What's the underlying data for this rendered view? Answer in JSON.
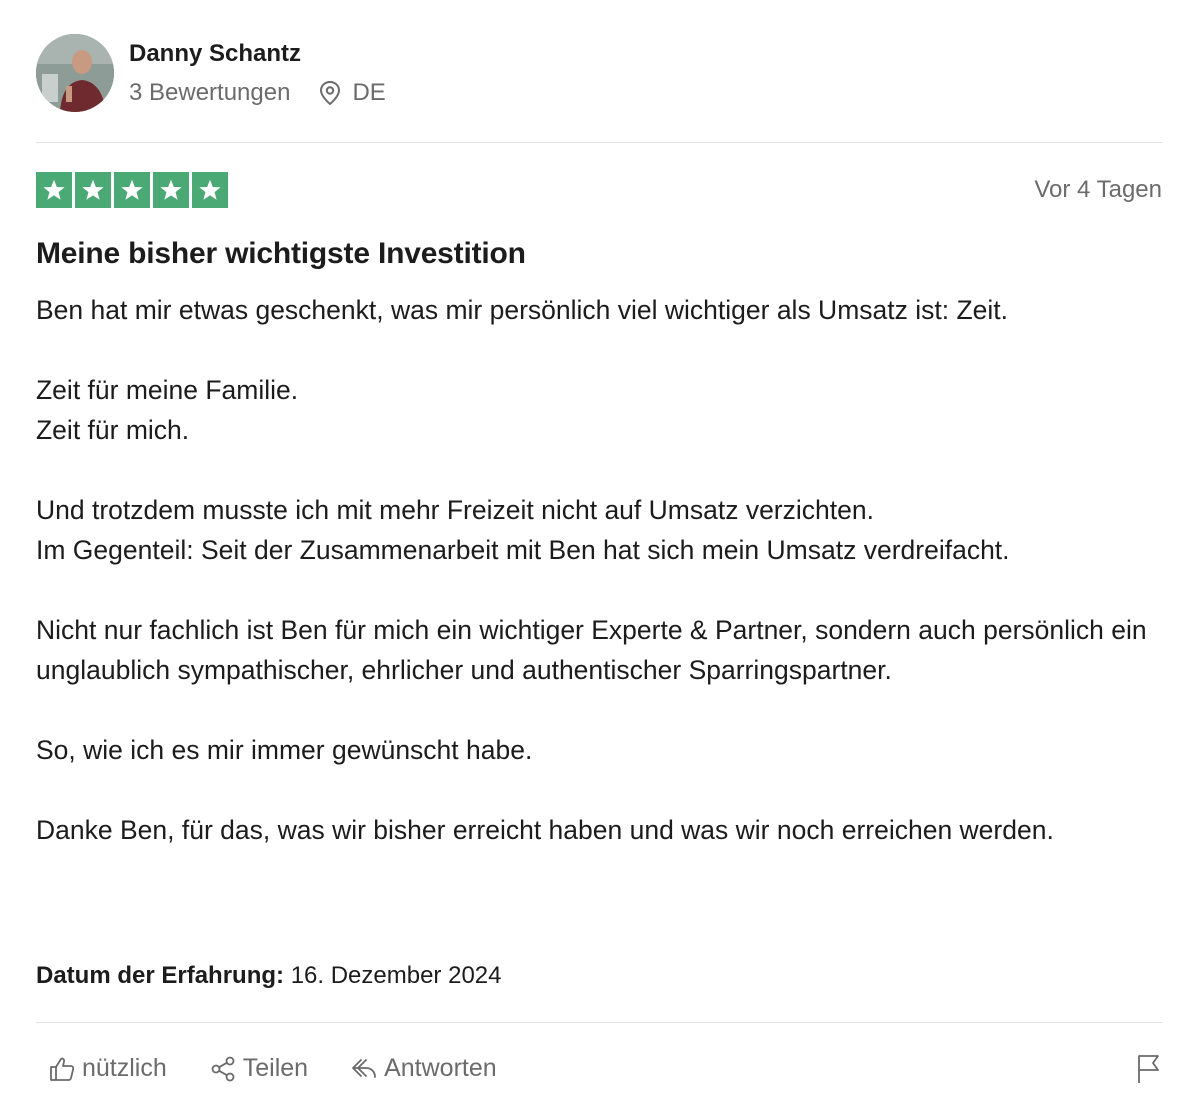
{
  "reviewer": {
    "name": "Danny Schantz",
    "reviews_count": "3 Bewertungen",
    "country": "DE"
  },
  "rating": {
    "stars": 5,
    "max_stars": 5,
    "color": "#4aa974"
  },
  "review": {
    "date": "Vor 4 Tagen",
    "title": "Meine bisher wichtigste Investition",
    "paragraphs": [
      [
        "Ben hat mir etwas geschenkt, was mir persönlich viel wichtiger als Umsatz ist: Zeit."
      ],
      [
        "Zeit für meine Familie.",
        "Zeit für mich."
      ],
      [
        "Und trotzdem musste ich mit mehr Freizeit nicht auf Umsatz verzichten.",
        "Im Gegenteil: Seit der Zusammenarbeit mit Ben hat sich mein Umsatz verdreifacht."
      ],
      [
        "Nicht nur fachlich ist Ben für mich ein wichtiger Experte & Partner, sondern auch persönlich ein unglaublich sympathischer, ehrlicher und authentischer Sparringspartner."
      ],
      [
        "So, wie ich es mir immer gewünscht habe."
      ],
      [
        "Danke Ben, für das, was wir bisher erreicht haben und was wir noch erreichen werden."
      ]
    ],
    "experience_label": "Datum der Erfahrung:",
    "experience_date": "16. Dezember 2024"
  },
  "actions": {
    "useful_label": "nützlich",
    "share_label": "Teilen",
    "reply_label": "Antworten",
    "icons": {
      "useful": "thumbs-up-icon",
      "share": "share-icon",
      "reply": "reply-icon",
      "report": "flag-icon"
    }
  }
}
